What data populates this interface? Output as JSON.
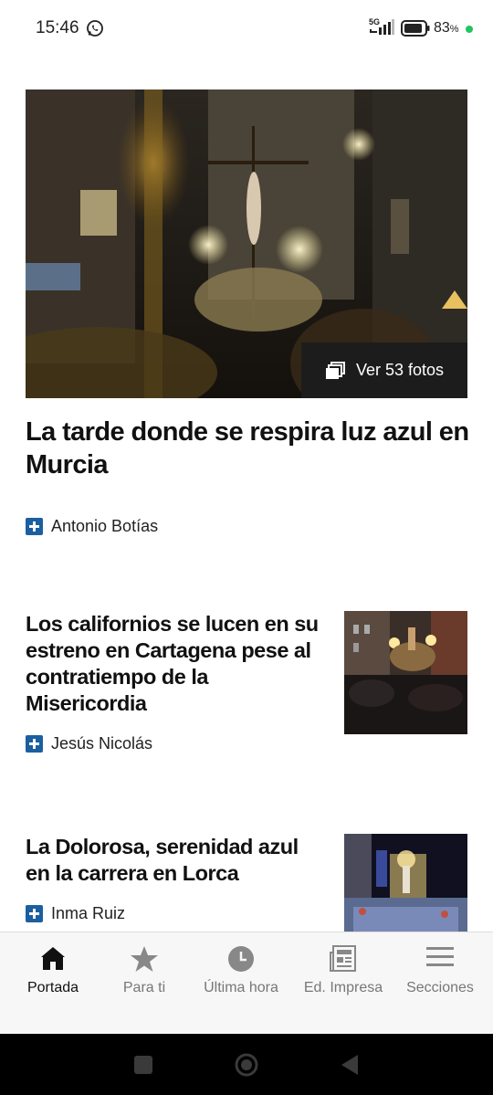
{
  "status_bar": {
    "time": "15:46",
    "network": "5G",
    "battery_pct": "83",
    "battery_unit": "%",
    "whatsapp_icon": "whatsapp-icon"
  },
  "hero": {
    "photos_label": "Ver 53 fotos",
    "headline": "La tarde donde se respira luz azul en Murcia",
    "author": "Antonio Botías"
  },
  "articles": [
    {
      "title": "Los californios se lucen en su estreno en Cartagena pese al contratiempo de la Misericordia",
      "author": "Jesús Nicolás"
    },
    {
      "title": "La Dolorosa, serenidad azul en la carrera en Lorca",
      "author": "Inma Ruiz"
    }
  ],
  "bottom_nav": {
    "items": [
      {
        "label": "Portada",
        "icon": "home-icon",
        "active": true
      },
      {
        "label": "Para ti",
        "icon": "star-icon"
      },
      {
        "label": "Última hora",
        "icon": "clock-icon"
      },
      {
        "label": "Ed. Impresa",
        "icon": "newspaper-icon"
      },
      {
        "label": "Secciones",
        "icon": "menu-icon"
      }
    ]
  },
  "colors": {
    "accent": "#1b5fa0",
    "battery_dot": "#22c55e"
  }
}
